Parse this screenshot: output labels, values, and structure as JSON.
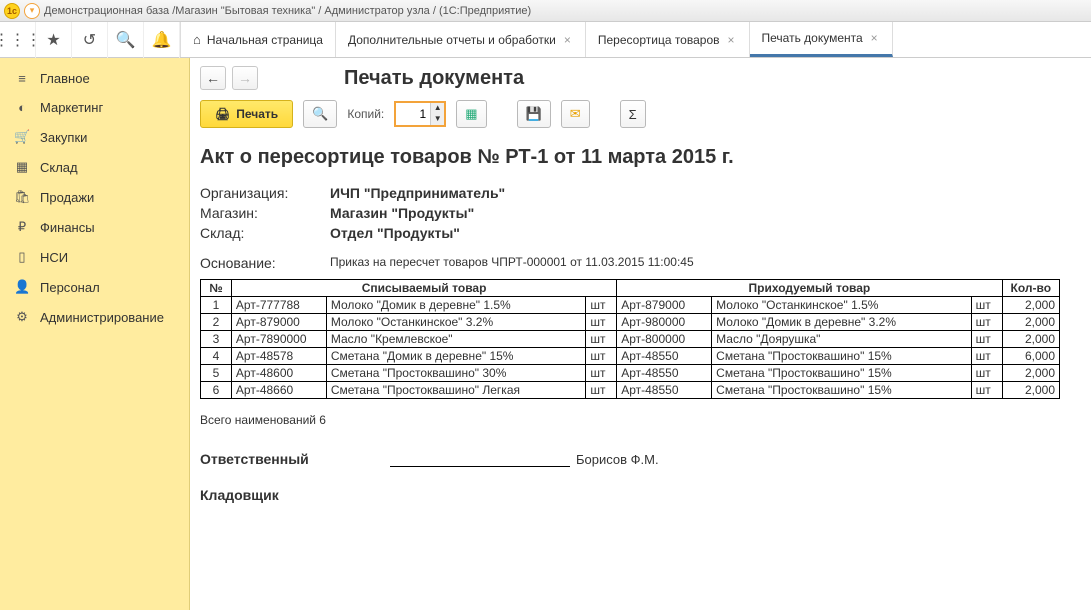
{
  "window_title": "Демонстрационная база /Магазин \"Бытовая техника\" / Администратор узла / (1С:Предприятие)",
  "tabs": [
    {
      "label": "Начальная страница",
      "closable": false,
      "home": true
    },
    {
      "label": "Дополнительные отчеты и обработки",
      "closable": true
    },
    {
      "label": "Пересортица товаров",
      "closable": true
    },
    {
      "label": "Печать документа",
      "closable": true,
      "active": true
    }
  ],
  "sidebar": [
    {
      "icon": "≡",
      "label": "Главное"
    },
    {
      "icon": "◐",
      "label": "Маркетинг"
    },
    {
      "icon": "🛒",
      "label": "Закупки"
    },
    {
      "icon": "▦",
      "label": "Склад"
    },
    {
      "icon": "🛍",
      "label": "Продажи"
    },
    {
      "icon": "₽",
      "label": "Финансы"
    },
    {
      "icon": "▯",
      "label": "НСИ"
    },
    {
      "icon": "👤",
      "label": "Персонал"
    },
    {
      "icon": "⚙",
      "label": "Администрирование"
    }
  ],
  "page_title": "Печать документа",
  "actions": {
    "print": "Печать",
    "copies_label": "Копий:",
    "copies_value": "1"
  },
  "doc": {
    "heading": "Акт о пересортице товаров № РТ-1 от 11 марта 2015 г.",
    "org_label": "Организация:",
    "org": "ИЧП \"Предприниматель\"",
    "shop_label": "Магазин:",
    "shop": "Магазин \"Продукты\"",
    "wh_label": "Склад:",
    "wh": "Отдел \"Продукты\"",
    "basis_label": "Основание:",
    "basis": "Приказ на пересчет товаров ЧПРТ-000001 от 11.03.2015 11:00:45",
    "col_num": "№",
    "col_out": "Списываемый товар",
    "col_in": "Приходуемый товар",
    "col_qty": "Кол-во",
    "rows": [
      {
        "n": "1",
        "oa": "Арт-777788",
        "on": "Молоко \"Домик в деревне\" 1.5%",
        "ou": "шт",
        "ia": "Арт-879000",
        "in": "Молоко \"Останкинское\" 1.5%",
        "iu": "шт",
        "q": "2,000"
      },
      {
        "n": "2",
        "oa": "Арт-879000",
        "on": "Молоко \"Останкинское\" 3.2%",
        "ou": "шт",
        "ia": "Арт-980000",
        "in": "Молоко \"Домик в деревне\" 3.2%",
        "iu": "шт",
        "q": "2,000"
      },
      {
        "n": "3",
        "oa": "Арт-7890000",
        "on": "Масло \"Кремлевское\"",
        "ou": "шт",
        "ia": "Арт-800000",
        "in": "Масло \"Доярушка\"",
        "iu": "шт",
        "q": "2,000"
      },
      {
        "n": "4",
        "oa": "Арт-48578",
        "on": "Сметана \"Домик в деревне\" 15%",
        "ou": "шт",
        "ia": "Арт-48550",
        "in": "Сметана \"Простоквашино\" 15%",
        "iu": "шт",
        "q": "6,000"
      },
      {
        "n": "5",
        "oa": "Арт-48600",
        "on": "Сметана \"Простоквашино\" 30%",
        "ou": "шт",
        "ia": "Арт-48550",
        "in": "Сметана \"Простоквашино\" 15%",
        "iu": "шт",
        "q": "2,000"
      },
      {
        "n": "6",
        "oa": "Арт-48660",
        "on": "Сметана \"Простоквашино\" Легкая",
        "ou": "шт",
        "ia": "Арт-48550",
        "in": "Сметана \"Простоквашино\" 15%",
        "iu": "шт",
        "q": "2,000"
      }
    ],
    "total": "Всего наименований 6",
    "resp_label": "Ответственный",
    "resp_name": "Борисов Ф.М.",
    "store_label": "Кладовщик"
  }
}
